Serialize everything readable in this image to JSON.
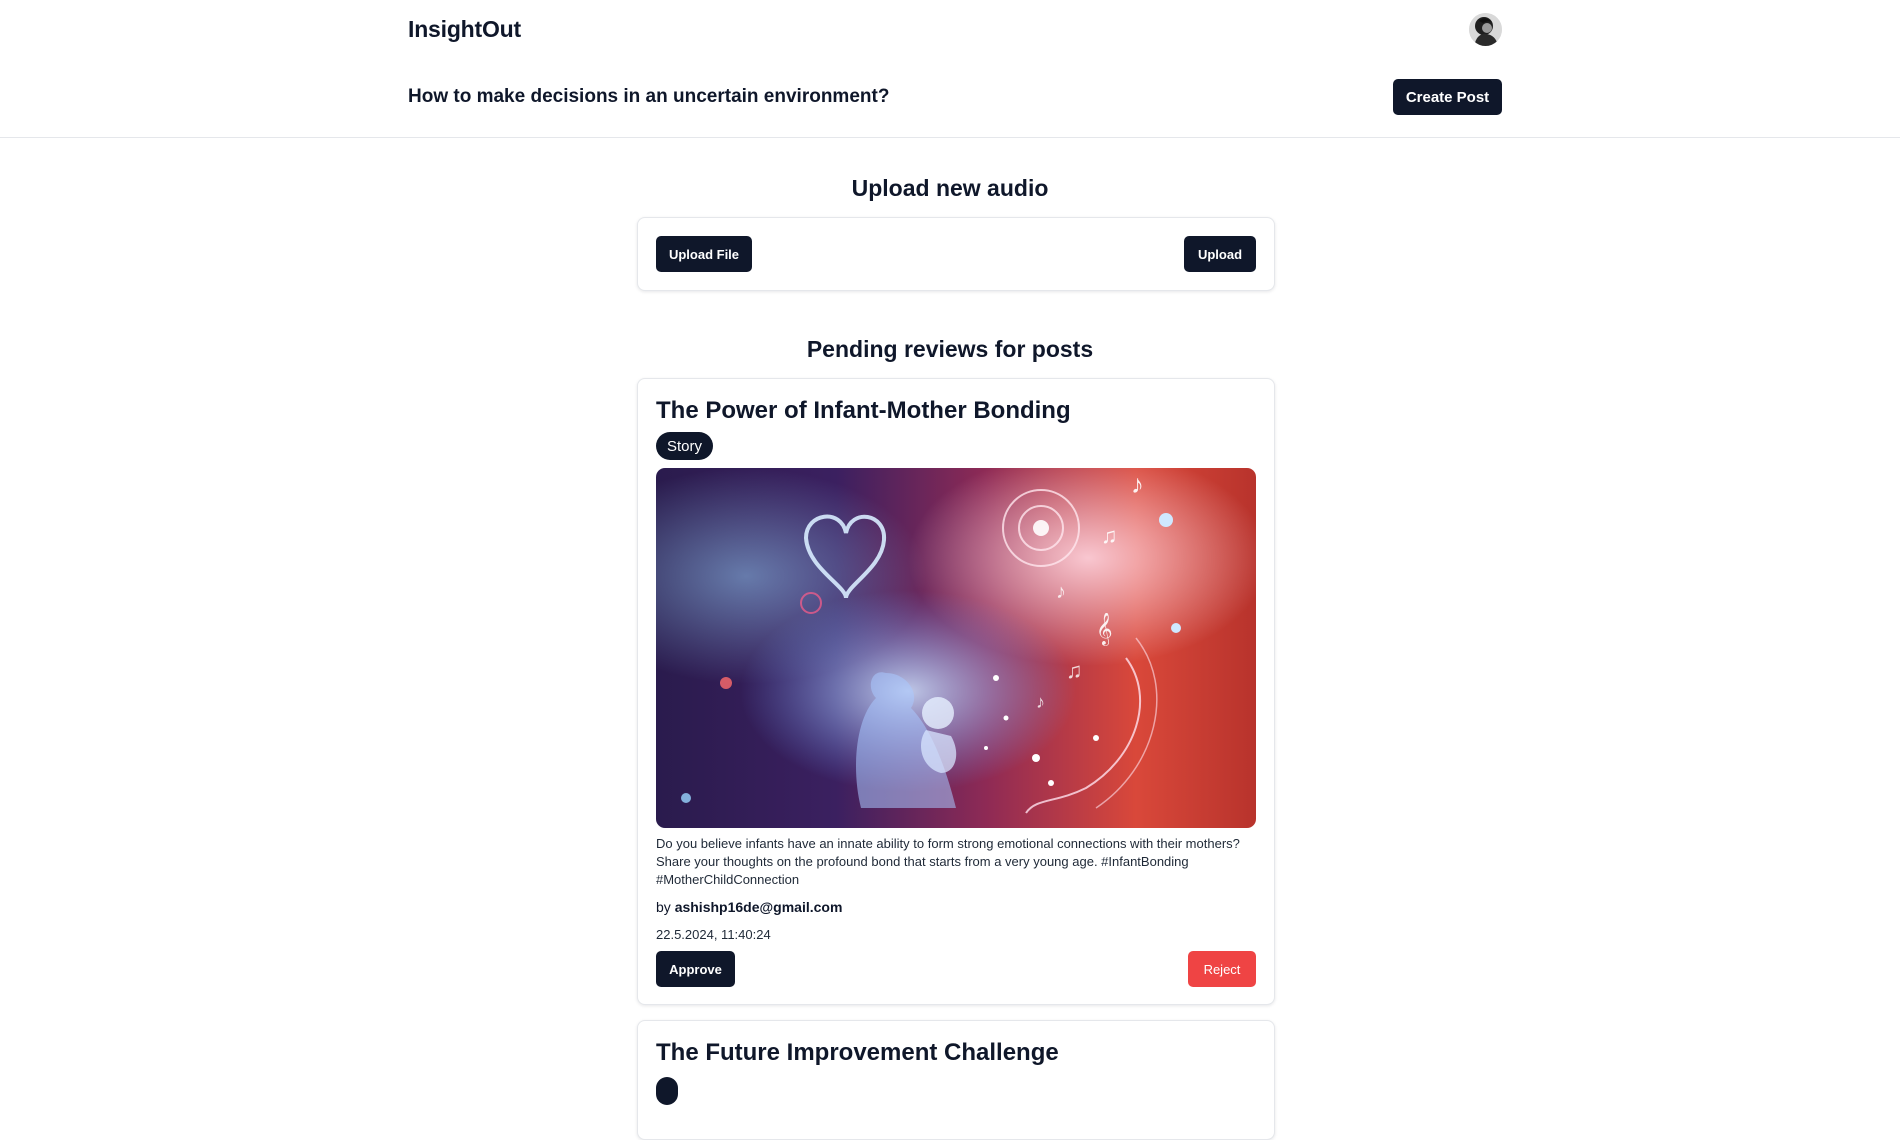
{
  "app": {
    "brand": "InsightOut"
  },
  "header": {
    "question": "How to make decisions in an uncertain environment?",
    "create_post_label": "Create Post"
  },
  "upload": {
    "title": "Upload new audio",
    "upload_file_label": "Upload File",
    "upload_label": "Upload"
  },
  "reviews": {
    "title": "Pending reviews for posts",
    "posts": [
      {
        "title": "The Power of Infant-Mother Bonding",
        "tag": "Story",
        "body": "Do you believe infants have an innate ability to form strong emotional connections with their mothers? Share your thoughts on the profound bond that starts from a very young age. #InfantBonding #MotherChildConnection",
        "by_label": "by",
        "author": "ashishp16de@gmail.com",
        "timestamp": "22.5.2024, 11:40:24",
        "approve_label": "Approve",
        "reject_label": "Reject"
      },
      {
        "title": "The Future Improvement Challenge",
        "tag": ""
      }
    ]
  },
  "colors": {
    "primary": "#0f172a",
    "danger": "#ef4444",
    "border": "#e5e7eb"
  }
}
